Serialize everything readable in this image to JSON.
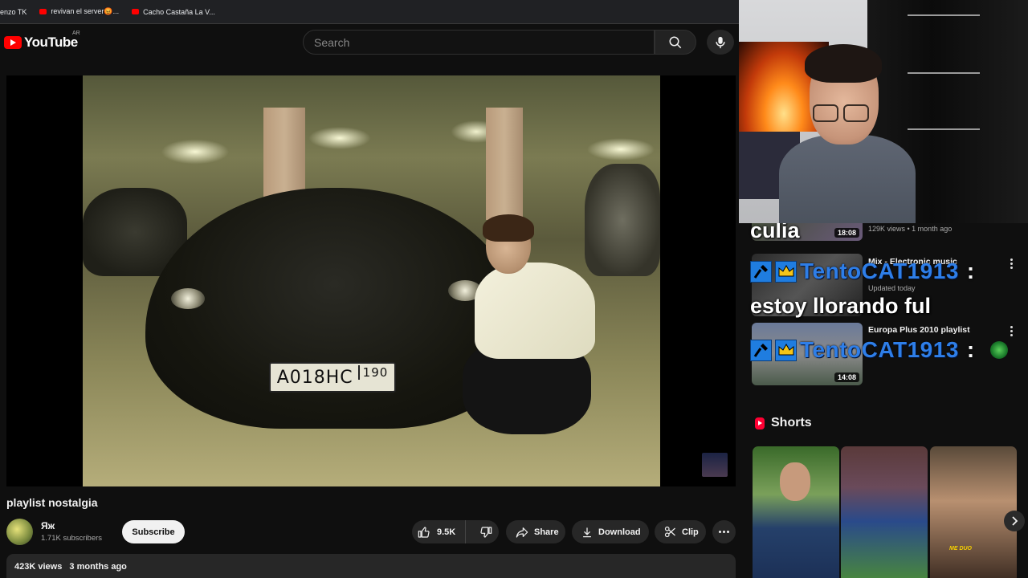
{
  "bookmarks": [
    {
      "label": "enzo TK",
      "icon": "none"
    },
    {
      "label": "revivan el server😡...",
      "icon": "youtube-icon"
    },
    {
      "label": "Cacho Castaña La V...",
      "icon": "youtube-icon"
    }
  ],
  "header": {
    "logo_text": "YouTube",
    "region": "AR",
    "search_placeholder": "Search"
  },
  "video": {
    "plate_main": "А018НС",
    "plate_region": "190",
    "title": "playlist nostalgia",
    "channel_name": "Яж",
    "subscribers": "1.71K subscribers",
    "subscribe_label": "Subscribe",
    "likes": "9.5K",
    "share_label": "Share",
    "download_label": "Download",
    "clip_label": "Clip",
    "views": "423K views",
    "published": "3 months ago"
  },
  "recommendations": [
    {
      "title": "",
      "meta_line1": "129K views • 1 month ago",
      "duration": "18:08"
    },
    {
      "title": "Mix - Electronic music",
      "meta_line1": "Updated today",
      "duration": ""
    },
    {
      "title": "Europa Plus 2010 playlist",
      "meta_line1": "",
      "duration": "14:08"
    }
  ],
  "chat_overlay": {
    "message1": "culia",
    "user1": "TentoCAT1913",
    "message2": "estoy llorando ful",
    "user2": "TentoCAT1913",
    "colon": ":"
  },
  "shorts": {
    "title": "Shorts",
    "items": [
      {
        "label": ""
      },
      {
        "label": ""
      },
      {
        "label": "ME DUO"
      }
    ]
  },
  "colors": {
    "accent_red": "#ff0000",
    "chat_user_blue": "#2e7ee8",
    "badge_blue": "#1f7de0",
    "background": "#0f0f0f"
  }
}
